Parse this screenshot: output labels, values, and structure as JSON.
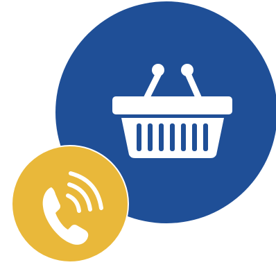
{
  "colors": {
    "background": "#ffffff",
    "blue_circle": "#1f4f97",
    "yellow_circle": "#e9b83a",
    "icon_fill": "#ffffff"
  },
  "icons": {
    "large": "shopping-basket-icon",
    "small": "phone-call-icon"
  }
}
